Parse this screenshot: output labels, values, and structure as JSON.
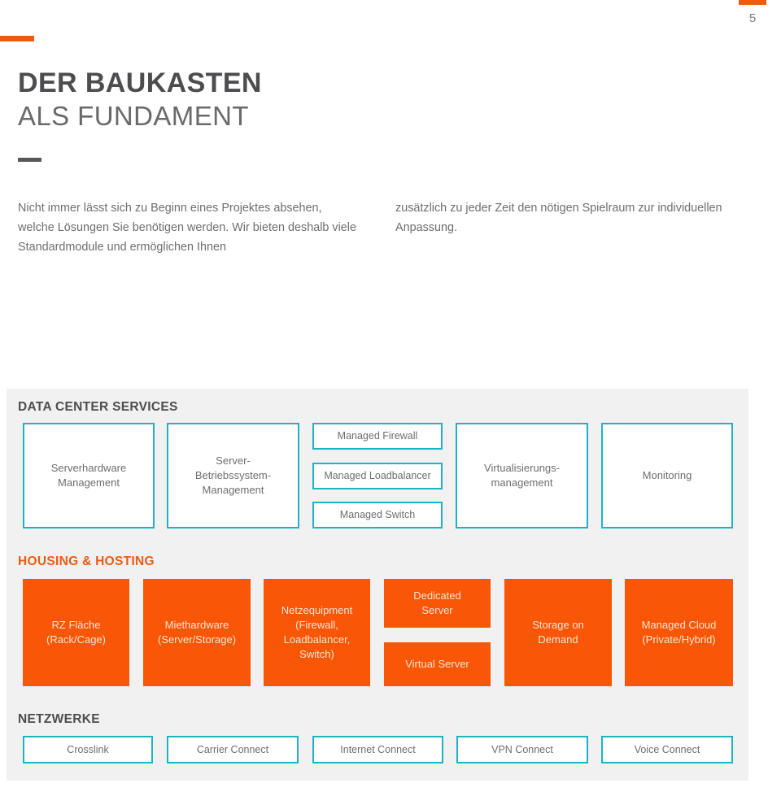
{
  "page": {
    "number": "5",
    "accent_orange": "#ef5a12",
    "box_orange": "#f95608",
    "accent_teal": "#1fb2c3",
    "panel_gray": "#f1f1f1",
    "text_gray": "#6e6e70"
  },
  "title": {
    "line1": "DER BAUKASTEN",
    "line2": "ALS FUNDAMENT"
  },
  "intro": {
    "left": "Nicht immer lässt sich zu Beginn eines Projektes absehen, welche Lösungen Sie benötigen werden. Wir bieten deshalb viele Standardmodule und ermöglichen Ihnen",
    "right": "zusätzlich zu jeder Zeit den nötigen Spielraum zur individuellen Anpassung."
  },
  "sections": {
    "data_center_services": {
      "heading": "DATA CENTER SERVICES",
      "items": [
        {
          "label": "Serverhardware\nManagement",
          "style": "teal-large"
        },
        {
          "label": "Server-\nBetriebssystem-\nManagement",
          "style": "teal-large"
        },
        {
          "label": "Managed Firewall",
          "style": "teal-small"
        },
        {
          "label": "Managed Loadbalancer",
          "style": "teal-small"
        },
        {
          "label": "Managed Switch",
          "style": "teal-small"
        },
        {
          "label": "Virtualisierungs-\nmanagement",
          "style": "teal-large"
        },
        {
          "label": "Monitoring",
          "style": "teal-large"
        }
      ]
    },
    "housing_hosting": {
      "heading": "HOUSING & HOSTING",
      "items": [
        {
          "label": "RZ Fläche\n(Rack/Cage)",
          "style": "orange-large"
        },
        {
          "label": "Miethardware\n(Server/Storage)",
          "style": "orange-large"
        },
        {
          "label": "Netzequipment\n(Firewall,\nLoadbalancer,\nSwitch)",
          "style": "orange-large"
        },
        {
          "label": "Dedicated\nServer",
          "style": "orange-small"
        },
        {
          "label": "Virtual Server",
          "style": "orange-small"
        },
        {
          "label": "Storage on\nDemand",
          "style": "orange-large"
        },
        {
          "label": "Managed Cloud\n(Private/Hybrid)",
          "style": "orange-large"
        }
      ]
    },
    "netzwerke": {
      "heading": "NETZWERKE",
      "items": [
        {
          "label": "Crosslink"
        },
        {
          "label": "Carrier Connect"
        },
        {
          "label": "Internet Connect"
        },
        {
          "label": "VPN Connect"
        },
        {
          "label": "Voice Connect"
        }
      ]
    }
  }
}
